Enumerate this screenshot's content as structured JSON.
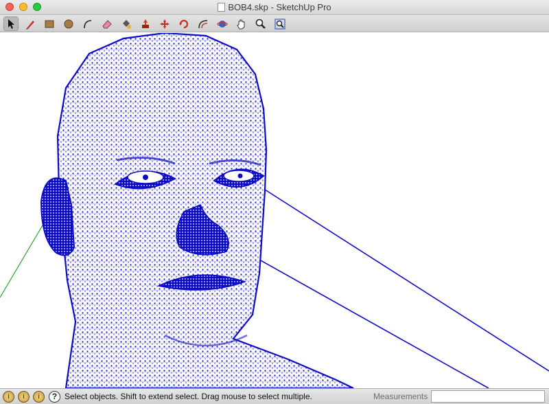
{
  "window": {
    "title": "BOB4.skp - SketchUp Pro"
  },
  "toolbar": {
    "tools": [
      {
        "name": "select-tool",
        "icon": "arrow-cursor-icon",
        "active": true
      },
      {
        "name": "line-tool",
        "icon": "pencil-icon"
      },
      {
        "name": "rectangle-tool",
        "icon": "rectangle-icon"
      },
      {
        "name": "circle-tool",
        "icon": "circle-icon"
      },
      {
        "name": "arc-tool",
        "icon": "arc-icon"
      },
      {
        "name": "eraser-tool",
        "icon": "eraser-icon"
      },
      {
        "name": "paint-bucket-tool",
        "icon": "paint-bucket-icon"
      },
      {
        "name": "push-pull-tool",
        "icon": "push-pull-icon"
      },
      {
        "name": "move-tool",
        "icon": "move-arrows-icon"
      },
      {
        "name": "rotate-tool",
        "icon": "rotate-icon"
      },
      {
        "name": "offset-tool",
        "icon": "offset-icon"
      },
      {
        "name": "orbit-tool",
        "icon": "orbit-icon"
      },
      {
        "name": "pan-tool",
        "icon": "hand-icon"
      },
      {
        "name": "zoom-tool",
        "icon": "magnifier-icon"
      },
      {
        "name": "zoom-extents-tool",
        "icon": "zoom-extents-icon"
      }
    ]
  },
  "canvas": {
    "model_color": "#0b0bc8",
    "green_axis_color": "#2aa02a"
  },
  "statusbar": {
    "icons": [
      "geo-location-icon",
      "credits-icon",
      "sign-in-icon",
      "help-icon"
    ],
    "help_glyph": "?",
    "message": "Select objects. Shift to extend select. Drag mouse to select multiple.",
    "measurements_label": "Measurements",
    "measurements_value": ""
  }
}
